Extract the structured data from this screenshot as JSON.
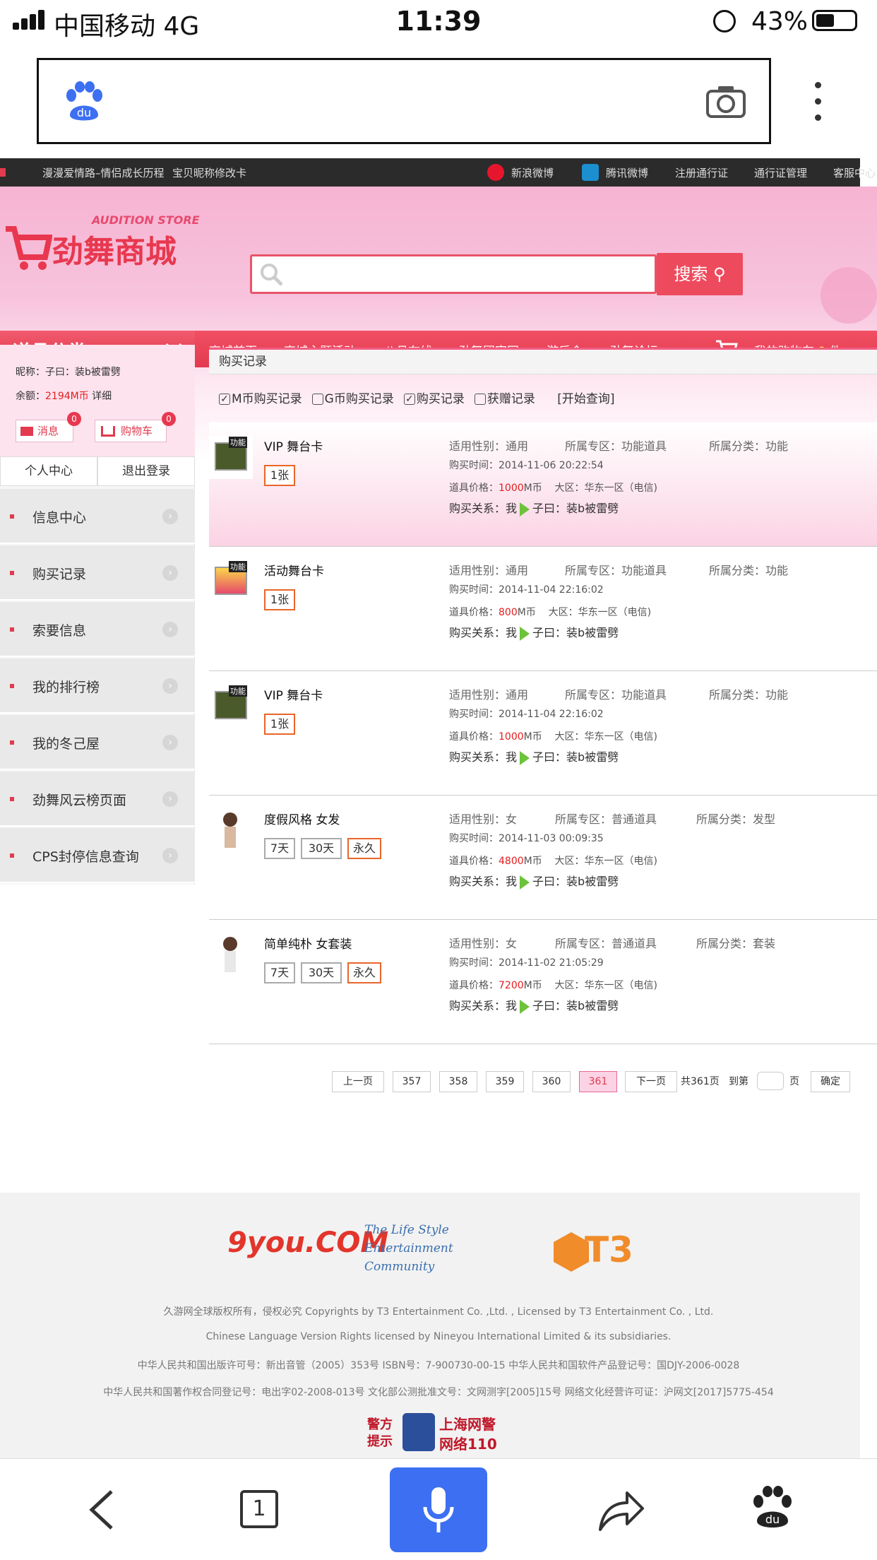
{
  "status_bar": {
    "carrier": "中国移动  4G",
    "time": "11:39",
    "battery": "43%"
  },
  "top_strip": {
    "links": [
      "漫漫爱情路–情侣成长历程",
      "宝贝昵称修改卡"
    ],
    "right": [
      "新浪微博",
      "腾讯微博",
      "注册通行证",
      "通行证管理",
      "客服中心"
    ]
  },
  "logo": {
    "en": "AUDITION  STORE",
    "cn": "劲舞商城"
  },
  "search": {
    "button": "搜索"
  },
  "nav": {
    "category": "道具分类",
    "items": [
      "商城首页",
      "商城主题活动",
      "八月在线",
      "劲舞团官网",
      "游乐会",
      "劲舞论坛"
    ],
    "cart_label": "我的购物车",
    "cart_count": "0",
    "cart_unit": "件"
  },
  "user": {
    "nick_label": "昵称：",
    "nick": "子曰：装b被雷劈",
    "balance_label": "余额：",
    "balance": "2194M币",
    "detail": "详细",
    "msg": "消息",
    "msg_count": "0",
    "cart": "购物车",
    "cart_count": "0",
    "center": "个人中心",
    "logout": "退出登录"
  },
  "side_menu": [
    "信息中心",
    "购买记录",
    "索要信息",
    "我的排行榜",
    "我的冬己屋",
    "劲舞风云榜页面",
    "CPS封停信息查询"
  ],
  "main": {
    "title": "购买记录",
    "filters": [
      "M币购买记录",
      "G币购买记录",
      "购买记录",
      "获赠记录"
    ],
    "filters_checked": [
      true,
      false,
      true,
      false
    ],
    "query": "[开始查询]"
  },
  "labels": {
    "gender": "适用性别：",
    "zone": "所属专区：",
    "category": "所属分类：",
    "time": "购买时间：",
    "price": "道具价格：",
    "currency": "M币",
    "region": "大区：",
    "relation": "购买关系：",
    "me": "我",
    "badge_text": "功能"
  },
  "records": [
    {
      "name": "VIP 舞台卡",
      "options": [
        "1张"
      ],
      "selected": 0,
      "gender": "通用",
      "zone": "功能道具",
      "category": "功能",
      "time": "2014-11-06 20:22:54",
      "price": "1000",
      "region": "华东一区（电信)",
      "to": "子曰：装b被雷劈"
    },
    {
      "name": "活动舞台卡",
      "options": [
        "1张"
      ],
      "selected": 0,
      "gender": "通用",
      "zone": "功能道具",
      "category": "功能",
      "time": "2014-11-04 22:16:02",
      "price": "800",
      "region": "华东一区（电信)",
      "to": "子曰：装b被雷劈"
    },
    {
      "name": "VIP 舞台卡",
      "options": [
        "1张"
      ],
      "selected": 0,
      "gender": "通用",
      "zone": "功能道具",
      "category": "功能",
      "time": "2014-11-04 22:16:02",
      "price": "1000",
      "region": "华东一区（电信)",
      "to": "子曰：装b被雷劈"
    },
    {
      "name": "度假风格 女发",
      "options": [
        "7天",
        "30天",
        "永久"
      ],
      "selected": 2,
      "gender": "女",
      "zone": "普通道具",
      "category": "发型",
      "time": "2014-11-03 00:09:35",
      "price": "4800",
      "region": "华东一区（电信)",
      "to": "子曰：装b被雷劈"
    },
    {
      "name": "简单纯朴 女套装",
      "options": [
        "7天",
        "30天",
        "永久"
      ],
      "selected": 2,
      "gender": "女",
      "zone": "普通道具",
      "category": "套装",
      "time": "2014-11-02 21:05:29",
      "price": "7200",
      "region": "华东一区（电信)",
      "to": "子曰：装b被雷劈"
    }
  ],
  "pager": {
    "prev": "上一页",
    "pages": [
      "357",
      "358",
      "359",
      "360",
      "361"
    ],
    "current": "361",
    "next": "下一页",
    "total": "共361页",
    "goto": "到第",
    "page_unit": "页",
    "confirm": "确定"
  },
  "footer": {
    "logos": [
      "9you.COM",
      "The Life Style Entertainment Community",
      "T3"
    ],
    "lines": [
      "久游网全球版权所有，侵权必究 Copyrights by T3 Entertainment Co. ,Ltd. , Licensed by T3 Entertainment Co. , Ltd.",
      "Chinese Language Version Rights licensed by Nineyou International Limited & its subsidiaries.",
      "中华人民共和国出版许可号：新出音管（2005）353号 ISBN号：7-900730-00-15 中华人民共和国软件产品登记号：国DJY-2006-0028",
      "中华人民共和国著作权合同登记号：电出字02-2008-013号 文化部公测批准文号：文网测字[2005]15号 网络文化经营许可证：沪网文[2017]5775-454"
    ],
    "police": [
      "警方",
      "提示",
      "上海网警",
      "网络110"
    ]
  },
  "bottom_bar": {
    "tab_count": "1"
  }
}
